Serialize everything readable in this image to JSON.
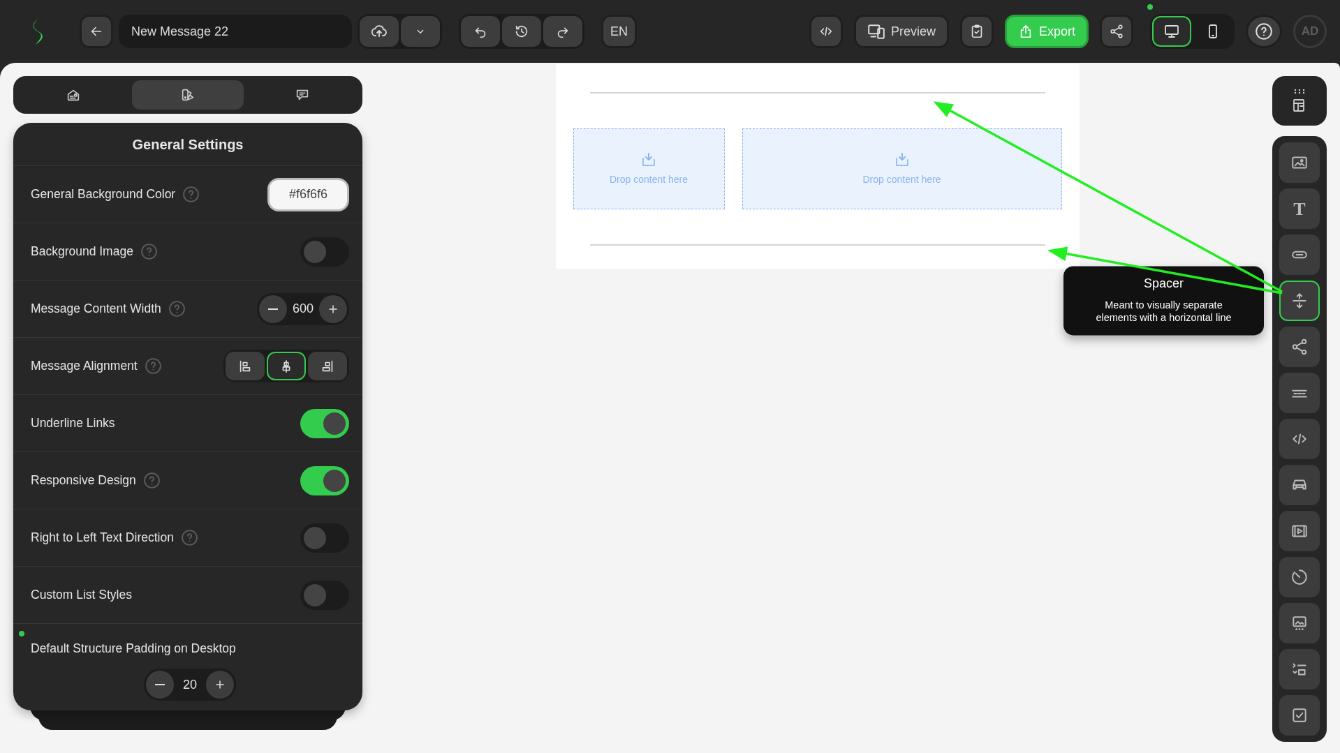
{
  "top_bar": {
    "title_field": "New Message 22",
    "language": "EN",
    "preview_label": "Preview",
    "export_label": "Export",
    "view_modes": [
      {
        "kind": "desktop",
        "selected": true
      },
      {
        "kind": "mobile",
        "selected": false
      }
    ],
    "user_initials": "AD"
  },
  "panel_tabs": [
    {
      "kind": "structure",
      "selected": false
    },
    {
      "kind": "style",
      "selected": true
    },
    {
      "kind": "comments",
      "selected": false
    }
  ],
  "settings": {
    "title": "General Settings",
    "rows": [
      {
        "kind": "color",
        "label": "General Background Color",
        "help": true,
        "value": "#f6f6f6"
      },
      {
        "kind": "toggle",
        "label": "Background Image",
        "help": true,
        "on": false
      },
      {
        "kind": "stepper",
        "label": "Message Content Width",
        "help": true,
        "value": "600"
      },
      {
        "kind": "alignment",
        "label": "Message Alignment",
        "help": true,
        "options": [
          {
            "kind": "left",
            "selected": false
          },
          {
            "kind": "center",
            "selected": true
          },
          {
            "kind": "right",
            "selected": false
          }
        ]
      },
      {
        "kind": "toggle",
        "label": "Underline Links",
        "help": false,
        "on": true
      },
      {
        "kind": "toggle",
        "label": "Responsive Design",
        "help": true,
        "on": true
      },
      {
        "kind": "toggle",
        "label": "Right to Left Text Direction",
        "help": true,
        "on": false
      },
      {
        "kind": "toggle",
        "label": "Custom List Styles",
        "help": false,
        "on": false
      },
      {
        "kind": "stepper_below",
        "label": "Default Structure Padding on Desktop",
        "help": false,
        "modified": true,
        "value": "20"
      }
    ]
  },
  "canvas": {
    "drop_zones": [
      {
        "text": "Drop content here"
      },
      {
        "text": "Drop content here"
      }
    ]
  },
  "toolbox": {
    "items": [
      {
        "kind": "image",
        "selected": false
      },
      {
        "kind": "text",
        "glyph": "T",
        "selected": false
      },
      {
        "kind": "button",
        "selected": false
      },
      {
        "kind": "spacer",
        "selected": true
      },
      {
        "kind": "social",
        "selected": false
      },
      {
        "kind": "menu",
        "selected": false
      },
      {
        "kind": "html",
        "selected": false
      },
      {
        "kind": "banner",
        "selected": false
      },
      {
        "kind": "video",
        "selected": false
      },
      {
        "kind": "timer",
        "selected": false
      },
      {
        "kind": "carousel",
        "selected": false
      },
      {
        "kind": "accordion",
        "selected": false
      },
      {
        "kind": "form",
        "selected": false
      }
    ],
    "tooltip": {
      "title": "Spacer",
      "text": "Meant to visually separate elements with a horizontal line"
    }
  }
}
